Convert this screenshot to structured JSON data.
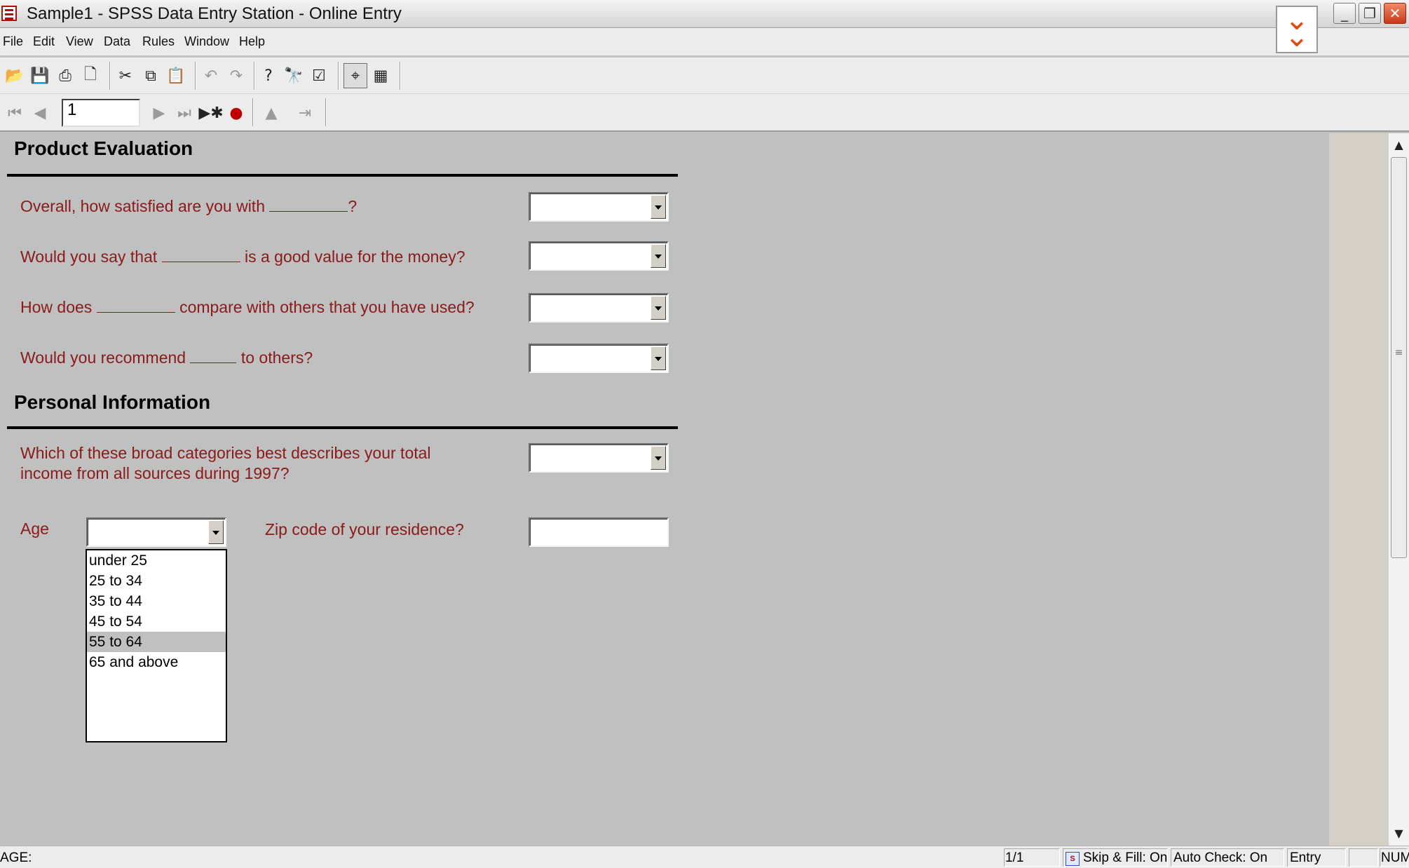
{
  "window": {
    "title": "Sample1 - SPSS Data Entry Station - Online Entry",
    "controls": [
      "minimize-icon",
      "restore-icon",
      "close-icon"
    ]
  },
  "menu": {
    "items": [
      "File",
      "Edit",
      "View",
      "Data",
      "Rules",
      "Window",
      "Help"
    ]
  },
  "toolbar": {
    "buttons": [
      "open-folder-icon",
      "save-icon",
      "print-icon",
      "print-preview-icon",
      "cut-icon",
      "copy-icon",
      "paste-icon",
      "undo-icon",
      "redo-icon",
      "help-icon",
      "find-icon",
      "check-icon",
      "form-view-icon",
      "grid-view-icon"
    ]
  },
  "navigation": {
    "record_number": "1",
    "buttons": [
      "first-record-icon",
      "previous-record-icon",
      "next-record-icon",
      "last-record-icon",
      "new-record-icon",
      "delete-record-icon",
      "rules-icon",
      "skip-icon"
    ]
  },
  "sections": {
    "product": {
      "title": "Product Evaluation",
      "questions": [
        {
          "before": "Overall, how satisfied are you with",
          "after": "?"
        },
        {
          "before": "Would you say that",
          "after": "is a good value for the money?"
        },
        {
          "before": "How does",
          "after": "compare with others that you have used?"
        },
        {
          "before": "Would you recommend",
          "after": "to others?"
        }
      ]
    },
    "personal": {
      "title": "Personal Information",
      "income_question_line1": "Which of these broad categories best describes your total",
      "income_question_line2": "income from all sources during 1997?",
      "age_label": "Age",
      "zip_label": "Zip code of your residence?"
    }
  },
  "age_dropdown": {
    "options": [
      "under 25",
      "25 to 34",
      "35 to 44",
      "45 to 54",
      "55 to 64",
      "65 and above"
    ],
    "highlighted": "55 to 64"
  },
  "status": {
    "field": "AGE:",
    "record": "1/1",
    "skip_fill": "Skip & Fill: On",
    "auto_check": "Auto Check: On",
    "mode": "Entry",
    "num": "NUM"
  },
  "colors": {
    "question_text": "#8b1a1a",
    "form_background": "#c0c0c0"
  }
}
